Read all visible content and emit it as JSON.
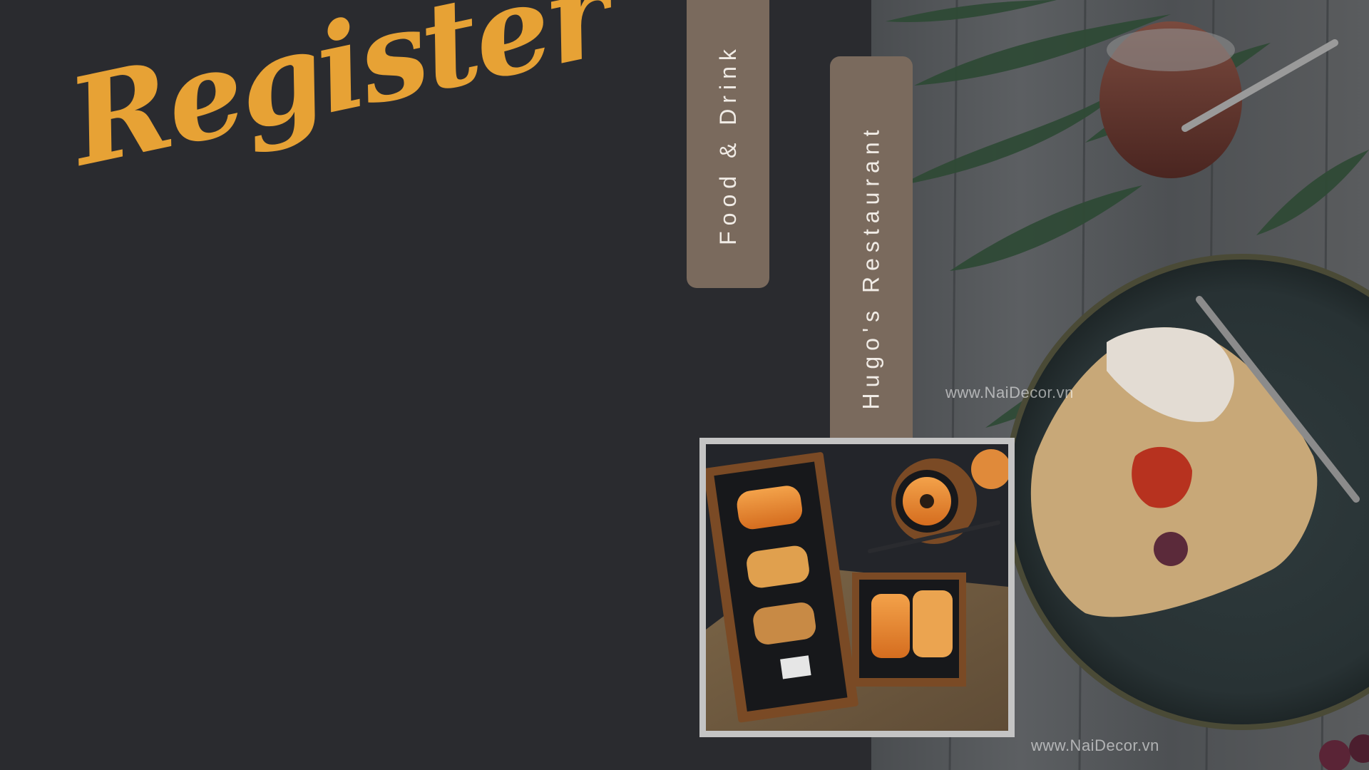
{
  "headline": "Register",
  "tags": {
    "food": "Food & Drink",
    "restaurant": "Hugo's Restaurant"
  },
  "watermarks": [
    "www.NaiDecor.vn",
    "www.NaiDecor.vn"
  ],
  "colors": {
    "background": "#2a2b2f",
    "accent": "#e7a235",
    "tag": "#7a6a5d",
    "tag_text": "#f1ece6",
    "frame": "#c4c4c4"
  },
  "images": {
    "background_photo": "table-scene-photo",
    "framed_photo": "bakery-pastries-photo"
  }
}
